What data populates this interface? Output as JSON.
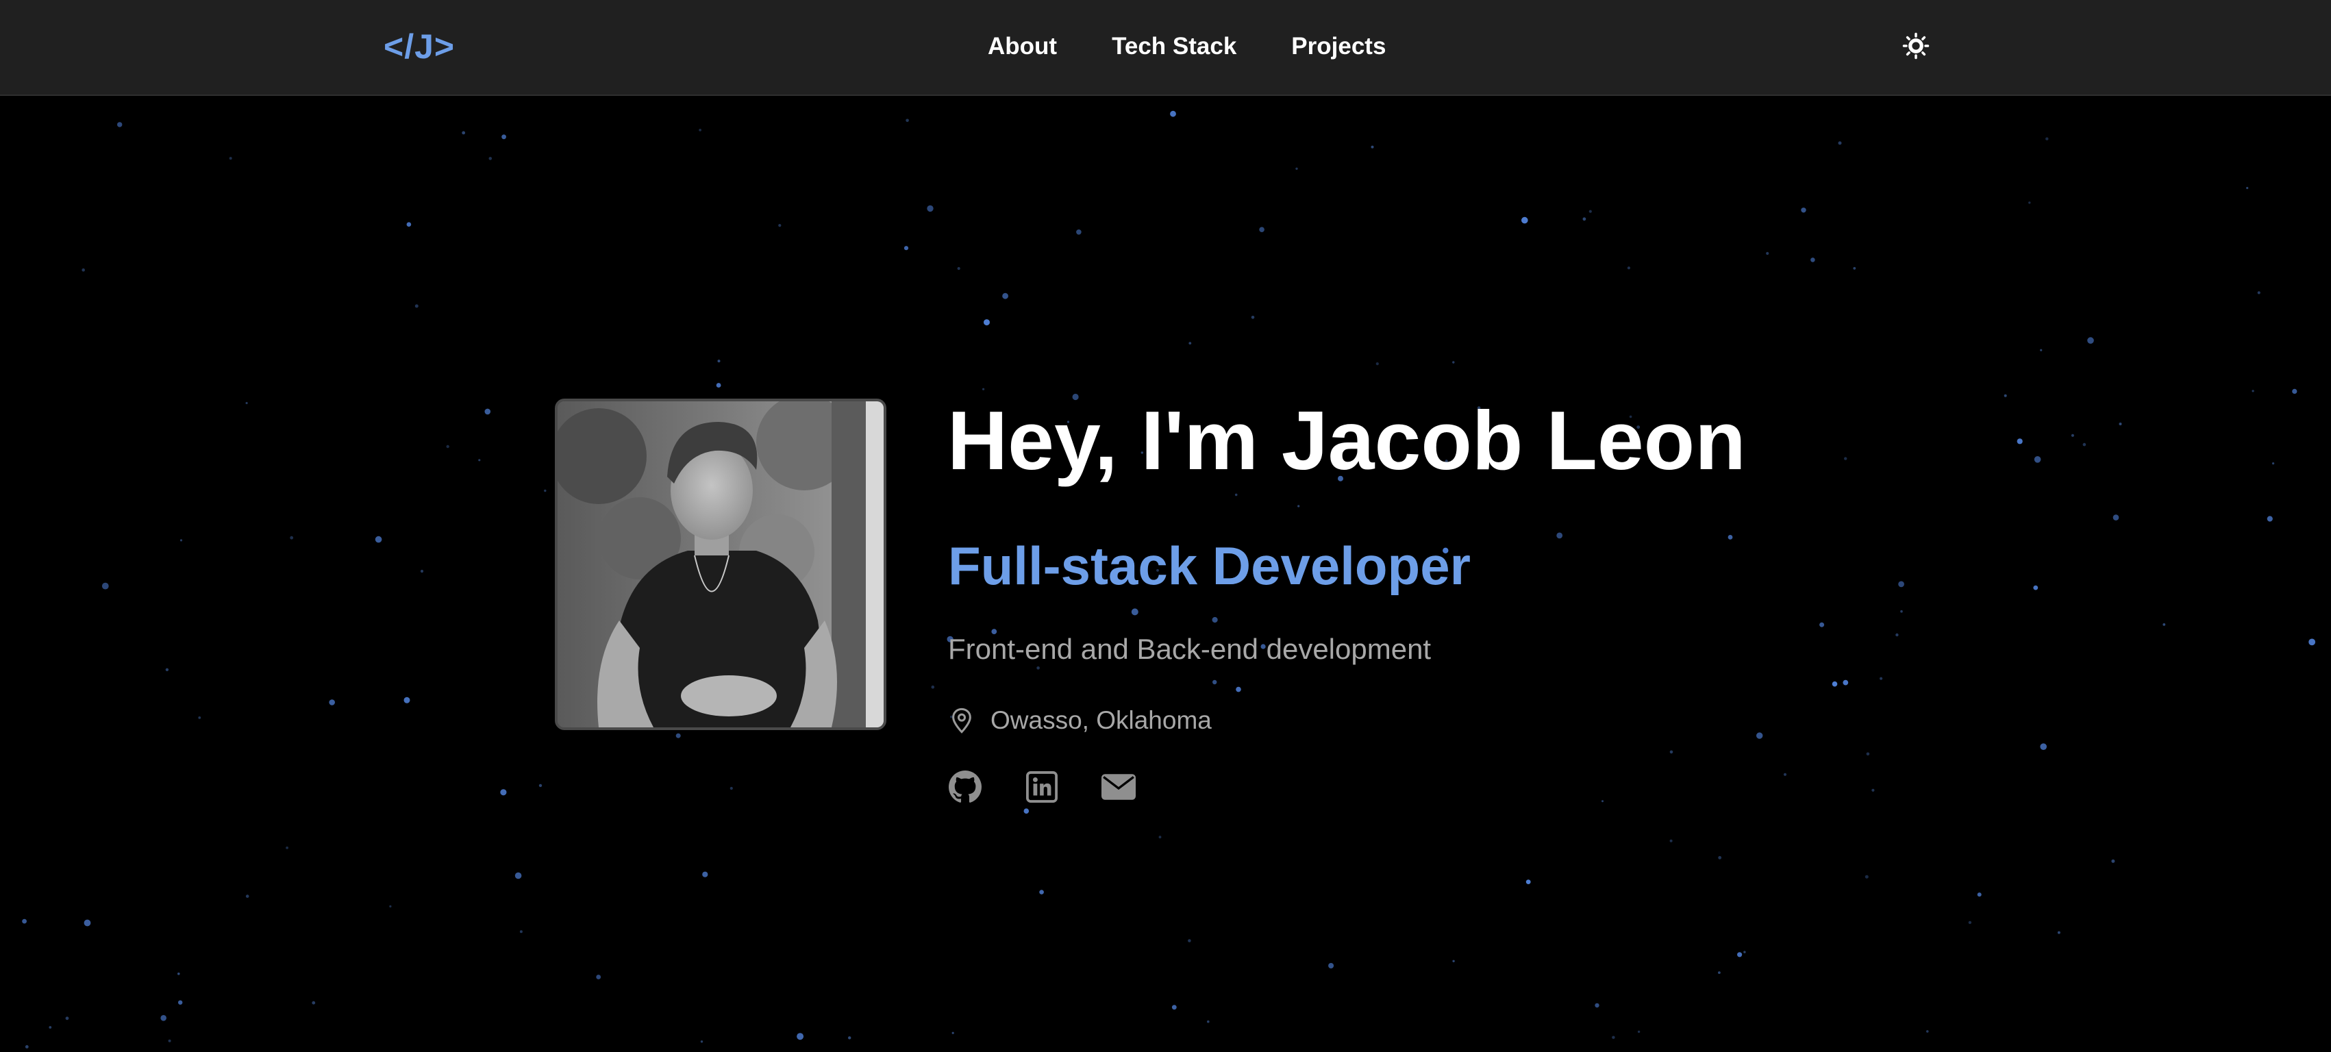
{
  "navbar": {
    "logo": "</J>",
    "links": [
      {
        "label": "About"
      },
      {
        "label": "Tech Stack"
      },
      {
        "label": "Projects"
      }
    ],
    "theme_toggle_icon": "sun-icon"
  },
  "hero": {
    "title": "Hey, I'm Jacob Leon",
    "role": "Full-stack Developer",
    "description": "Front-end and Back-end development",
    "location": "Owasso, Oklahoma",
    "location_icon": "map-pin-icon",
    "socials": [
      {
        "icon": "github-icon"
      },
      {
        "icon": "linkedin-icon"
      },
      {
        "icon": "email-icon"
      }
    ]
  },
  "colors": {
    "background": "#000000",
    "navbar": "#202020",
    "accent": "#6d9ee8",
    "text_primary": "#ffffff",
    "text_secondary": "#a8a8a8",
    "icon": "#9a9a9a",
    "star": "#4f7fd6"
  }
}
